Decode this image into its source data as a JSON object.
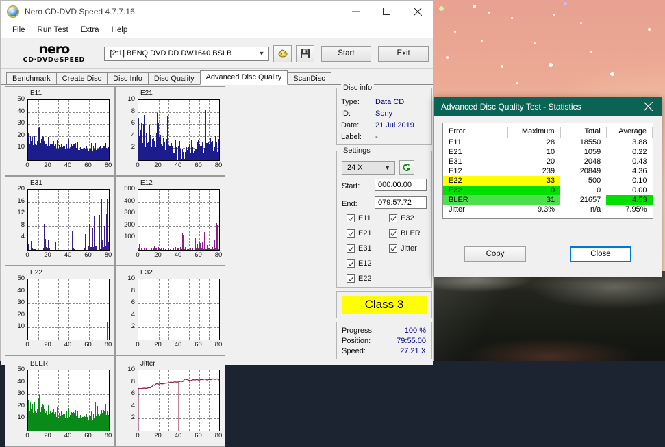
{
  "window": {
    "title": "Nero CD-DVD Speed 4.7.7.16",
    "icon": "nero-app-icon",
    "controls": {
      "minimize": "minimize-icon",
      "maximize": "maximize-icon",
      "close": "close-icon"
    }
  },
  "menu": {
    "items": [
      "File",
      "Run Test",
      "Extra",
      "Help"
    ]
  },
  "toolbar": {
    "logo_line1": "nero",
    "logo_line2": "CD·DVD⊘SPEED",
    "drive": "[2:1]   BENQ DVD DD DW1640 BSLB",
    "drive_arrow": "chevron-down-icon",
    "eject_icon": "eject-disc-icon",
    "save_icon": "floppy-save-icon",
    "start_label": "Start",
    "exit_label": "Exit"
  },
  "tabs": {
    "items": [
      "Benchmark",
      "Create Disc",
      "Disc Info",
      "Disc Quality",
      "Advanced Disc Quality",
      "ScanDisc"
    ],
    "active": "Advanced Disc Quality"
  },
  "disc_info": {
    "title": "Disc info",
    "rows": [
      {
        "label": "Type:",
        "value": "Data CD"
      },
      {
        "label": "ID:",
        "value": "Sony"
      },
      {
        "label": "Date:",
        "value": "21 Jul 2019"
      },
      {
        "label": "Label:",
        "value": "-"
      }
    ]
  },
  "settings": {
    "title": "Settings",
    "speed": "24 X",
    "speed_arrow": "chevron-down-icon",
    "refresh_icon": "refresh-speed-icon",
    "start_label": "Start:",
    "start_value": "000:00.00",
    "end_label": "End:",
    "end_value": "079:57.72",
    "checkboxes_left": [
      {
        "label": "E11",
        "checked": true
      },
      {
        "label": "E21",
        "checked": true
      },
      {
        "label": "E31",
        "checked": true
      },
      {
        "label": "E12",
        "checked": true
      },
      {
        "label": "E22",
        "checked": true
      }
    ],
    "checkboxes_right": [
      {
        "label": "E32",
        "checked": true
      },
      {
        "label": "BLER",
        "checked": true
      },
      {
        "label": "Jitter",
        "checked": true
      }
    ]
  },
  "class_result": {
    "label": "Class 3",
    "background": "#ffff00"
  },
  "progress_panel": {
    "rows": [
      {
        "label": "Progress:",
        "value": "100 %"
      },
      {
        "label": "Position:",
        "value": "79:55.00"
      },
      {
        "label": "Speed:",
        "value": "27.21 X"
      }
    ]
  },
  "stats_dialog": {
    "title": "Advanced Disc Quality Test - Statistics",
    "close_icon": "close-icon",
    "headers": [
      "Error",
      "Maximum",
      "Total",
      "Average"
    ],
    "rows": [
      {
        "error": "E11",
        "maximum": "28",
        "total": "18550",
        "average": "3.88",
        "highlight": null,
        "average_highlight": null
      },
      {
        "error": "E21",
        "maximum": "10",
        "total": "1059",
        "average": "0.22",
        "highlight": null,
        "average_highlight": null
      },
      {
        "error": "E31",
        "maximum": "20",
        "total": "2048",
        "average": "0.43",
        "highlight": null,
        "average_highlight": null
      },
      {
        "error": "E12",
        "maximum": "239",
        "total": "20849",
        "average": "4.36",
        "highlight": null,
        "average_highlight": null
      },
      {
        "error": "E22",
        "maximum": "33",
        "total": "500",
        "average": "0.10",
        "highlight": "#ffff00",
        "average_highlight": null
      },
      {
        "error": "E32",
        "maximum": "0",
        "total": "0",
        "average": "0.00",
        "highlight": "#00e000",
        "average_highlight": null
      },
      {
        "error": "BLER",
        "maximum": "31",
        "total": "21657",
        "average": "4.53",
        "highlight": "#4ce04c",
        "average_highlight": "#00e000"
      },
      {
        "error": "Jitter",
        "maximum": "9.3%",
        "total": "n/a",
        "average": "7.95%",
        "highlight": null,
        "average_highlight": null
      }
    ],
    "copy_label": "Copy",
    "close_label": "Close"
  },
  "chart_data": [
    {
      "type": "area",
      "title": "E11",
      "xlabel": "",
      "ylabel": "",
      "xlim": [
        0,
        80
      ],
      "ylim": [
        0,
        50
      ],
      "xticks": [
        0,
        20,
        40,
        60,
        80
      ],
      "yticks": [
        10,
        20,
        30,
        40,
        50
      ],
      "color": "#1c1c8c",
      "grid": true,
      "x": [
        0,
        1,
        2,
        3,
        4,
        5,
        6,
        7,
        8,
        9,
        10,
        11,
        12,
        13,
        14,
        15,
        16,
        17,
        18,
        19,
        20,
        21,
        22,
        23,
        24,
        25,
        26,
        27,
        28,
        29,
        30,
        31,
        32,
        33,
        34,
        35,
        36,
        37,
        38,
        39,
        40,
        41,
        42,
        43,
        44,
        45,
        46,
        47,
        48,
        49,
        50,
        51,
        52,
        53,
        54,
        55,
        56,
        57,
        58,
        59,
        60,
        61,
        62,
        63,
        64,
        65,
        66,
        67,
        68,
        69,
        70,
        71,
        72,
        73,
        74,
        75,
        76,
        77,
        78,
        79,
        80
      ],
      "values": [
        22,
        14,
        17,
        16,
        19,
        15,
        17,
        14,
        16,
        19,
        28,
        22,
        20,
        17,
        19,
        16,
        20,
        14,
        16,
        13,
        18,
        13,
        12,
        16,
        11,
        13,
        12,
        14,
        11,
        16,
        10,
        13,
        12,
        11,
        9,
        12,
        10,
        11,
        13,
        10,
        21,
        12,
        10,
        11,
        9,
        12,
        19,
        12,
        10,
        17,
        11,
        9,
        10,
        12,
        8,
        11,
        9,
        12,
        10,
        11,
        10,
        11,
        9,
        12,
        10,
        11,
        9,
        12,
        10,
        11,
        9,
        12,
        10,
        11,
        9,
        13,
        10,
        12,
        11,
        13,
        12
      ]
    },
    {
      "type": "area",
      "title": "E21",
      "xlabel": "",
      "ylabel": "",
      "xlim": [
        0,
        80
      ],
      "ylim": [
        0,
        10
      ],
      "xticks": [
        0,
        20,
        40,
        60,
        80
      ],
      "yticks": [
        2,
        4,
        6,
        8,
        10
      ],
      "color": "#1c1c8c",
      "grid": true,
      "x": [
        0,
        1,
        2,
        3,
        4,
        5,
        6,
        7,
        8,
        9,
        10,
        11,
        12,
        13,
        14,
        15,
        16,
        17,
        18,
        19,
        20,
        21,
        22,
        23,
        24,
        25,
        26,
        27,
        28,
        29,
        30,
        31,
        32,
        33,
        34,
        35,
        36,
        37,
        38,
        39,
        40,
        41,
        42,
        43,
        44,
        45,
        46,
        47,
        48,
        49,
        50,
        51,
        52,
        53,
        54,
        55,
        56,
        57,
        58,
        59,
        60,
        61,
        62,
        63,
        64,
        65,
        66,
        67,
        68,
        69,
        70,
        71,
        72,
        73,
        74,
        75,
        76,
        77,
        78,
        79,
        80
      ],
      "values": [
        7,
        2,
        4,
        7,
        2,
        9,
        4,
        2,
        6,
        3,
        2,
        5,
        4,
        2,
        5,
        3,
        4,
        2,
        6,
        8,
        5,
        2,
        4,
        3,
        2,
        5,
        3,
        2,
        4,
        7,
        3,
        2,
        4,
        2,
        3,
        1,
        2,
        4,
        1,
        0,
        3,
        4,
        1,
        0,
        2,
        1,
        0,
        3,
        2,
        1,
        3,
        2,
        1,
        4,
        2,
        1,
        3,
        2,
        1,
        4,
        2,
        3,
        1,
        2,
        4,
        1,
        3,
        7,
        2,
        4,
        3,
        1,
        4,
        2,
        3,
        1,
        2,
        6,
        3,
        1,
        4
      ]
    },
    {
      "type": "area",
      "title": "E31",
      "xlabel": "",
      "ylabel": "",
      "xlim": [
        0,
        80
      ],
      "ylim": [
        0,
        20
      ],
      "xticks": [
        0,
        20,
        40,
        60,
        80
      ],
      "yticks": [
        4,
        8,
        12,
        16,
        20
      ],
      "color": "#3d1f8c",
      "grid": true,
      "x": [
        0,
        1,
        2,
        3,
        4,
        5,
        6,
        7,
        8,
        9,
        10,
        11,
        12,
        13,
        14,
        15,
        16,
        17,
        18,
        19,
        20,
        21,
        22,
        23,
        24,
        25,
        26,
        27,
        28,
        29,
        30,
        31,
        32,
        33,
        34,
        35,
        36,
        37,
        38,
        39,
        40,
        41,
        42,
        43,
        44,
        45,
        46,
        47,
        48,
        49,
        50,
        51,
        52,
        53,
        54,
        55,
        56,
        57,
        58,
        59,
        60,
        61,
        62,
        63,
        64,
        65,
        66,
        67,
        68,
        69,
        70,
        71,
        72,
        73,
        74,
        75,
        76,
        77,
        78,
        79,
        80
      ],
      "values": [
        17,
        0,
        0,
        4,
        5,
        0,
        2,
        1,
        0,
        0,
        0,
        0,
        0,
        0,
        0,
        0,
        12,
        4,
        0,
        4,
        3,
        4,
        0,
        0,
        0,
        0,
        0,
        4,
        0,
        0,
        0,
        0,
        0,
        0,
        0,
        0,
        0,
        0,
        0,
        0,
        0,
        0,
        0,
        0,
        8,
        6,
        0,
        0,
        0,
        0,
        0,
        0,
        0,
        0,
        0,
        0,
        0,
        7,
        0,
        0,
        12,
        8,
        8,
        8,
        7,
        8,
        13,
        9,
        12,
        0,
        0,
        13,
        0,
        20,
        0,
        8,
        8,
        11,
        12,
        20,
        20
      ]
    },
    {
      "type": "area",
      "title": "E12",
      "xlabel": "",
      "ylabel": "",
      "xlim": [
        0,
        80
      ],
      "ylim": [
        0,
        500
      ],
      "xticks": [
        0,
        20,
        40,
        60,
        80
      ],
      "yticks": [
        100,
        200,
        300,
        400,
        500
      ],
      "color": "#8c1f8c",
      "grid": true,
      "x": [
        0,
        1,
        2,
        3,
        4,
        5,
        6,
        7,
        8,
        9,
        10,
        11,
        12,
        13,
        14,
        15,
        16,
        17,
        18,
        19,
        20,
        21,
        22,
        23,
        24,
        25,
        26,
        27,
        28,
        29,
        30,
        31,
        32,
        33,
        34,
        35,
        36,
        37,
        38,
        39,
        40,
        41,
        42,
        43,
        44,
        45,
        46,
        47,
        48,
        49,
        50,
        51,
        52,
        53,
        54,
        55,
        56,
        57,
        58,
        59,
        60,
        61,
        62,
        63,
        64,
        65,
        66,
        67,
        68,
        69,
        70,
        71,
        72,
        73,
        74,
        75,
        76,
        77,
        78,
        79,
        80
      ],
      "values": [
        140,
        10,
        20,
        15,
        20,
        10,
        15,
        10,
        20,
        15,
        10,
        25,
        15,
        20,
        10,
        15,
        45,
        20,
        15,
        25,
        20,
        15,
        30,
        10,
        20,
        15,
        10,
        40,
        15,
        20,
        10,
        25,
        30,
        15,
        20,
        10,
        15,
        25,
        20,
        10,
        20,
        15,
        30,
        25,
        170,
        60,
        30,
        20,
        15,
        40,
        25,
        15,
        20,
        25,
        15,
        20,
        25,
        130,
        60,
        40,
        190,
        50,
        60,
        90,
        50,
        70,
        195,
        60,
        50,
        30,
        190,
        35,
        40,
        30,
        20,
        60,
        80,
        110,
        230,
        190,
        60
      ]
    },
    {
      "type": "area",
      "title": "E22",
      "xlabel": "",
      "ylabel": "",
      "xlim": [
        0,
        80
      ],
      "ylim": [
        0,
        50
      ],
      "xticks": [
        0,
        20,
        40,
        60,
        80
      ],
      "yticks": [
        10,
        20,
        30,
        40,
        50
      ],
      "color": "#8c1f8c",
      "grid": true,
      "x": [
        0,
        10,
        20,
        30,
        40,
        50,
        60,
        70,
        78,
        79,
        80
      ],
      "values": [
        0,
        0,
        0,
        0,
        0,
        0,
        0,
        0,
        0,
        31,
        0
      ]
    },
    {
      "type": "area",
      "title": "E32",
      "xlabel": "",
      "ylabel": "",
      "xlim": [
        0,
        80
      ],
      "ylim": [
        0,
        10
      ],
      "xticks": [
        0,
        20,
        40,
        60,
        80
      ],
      "yticks": [
        2,
        4,
        6,
        8,
        10
      ],
      "color": "#8c1f8c",
      "grid": true,
      "x": [
        0,
        10,
        20,
        30,
        40,
        50,
        60,
        70,
        80
      ],
      "values": [
        0,
        0,
        0,
        0,
        0,
        0,
        0,
        0,
        0
      ]
    },
    {
      "type": "area",
      "title": "BLER",
      "xlabel": "",
      "ylabel": "",
      "xlim": [
        0,
        80
      ],
      "ylim": [
        0,
        50
      ],
      "xticks": [
        0,
        20,
        40,
        60,
        80
      ],
      "yticks": [
        10,
        20,
        30,
        40,
        50
      ],
      "color": "#0a8a19",
      "grid": true,
      "x": [
        0,
        1,
        2,
        3,
        4,
        5,
        6,
        7,
        8,
        9,
        10,
        11,
        12,
        13,
        14,
        15,
        16,
        17,
        18,
        19,
        20,
        21,
        22,
        23,
        24,
        25,
        26,
        27,
        28,
        29,
        30,
        31,
        32,
        33,
        34,
        35,
        36,
        37,
        38,
        39,
        40,
        41,
        42,
        43,
        44,
        45,
        46,
        47,
        48,
        49,
        50,
        51,
        52,
        53,
        54,
        55,
        56,
        57,
        58,
        59,
        60,
        61,
        62,
        63,
        64,
        65,
        66,
        67,
        68,
        69,
        70,
        71,
        72,
        73,
        74,
        75,
        76,
        77,
        78,
        79,
        80
      ],
      "values": [
        25,
        17,
        20,
        18,
        22,
        17,
        20,
        16,
        19,
        22,
        27,
        24,
        22,
        19,
        21,
        18,
        22,
        16,
        18,
        15,
        20,
        15,
        14,
        18,
        13,
        15,
        14,
        16,
        13,
        18,
        12,
        15,
        14,
        13,
        11,
        14,
        12,
        13,
        15,
        12,
        22,
        14,
        12,
        13,
        11,
        14,
        20,
        14,
        12,
        18,
        13,
        11,
        12,
        14,
        10,
        13,
        11,
        14,
        12,
        13,
        12,
        13,
        11,
        14,
        12,
        13,
        11,
        20,
        12,
        25,
        11,
        14,
        12,
        22,
        11,
        19,
        13,
        20,
        14,
        25,
        15
      ]
    },
    {
      "type": "line",
      "title": "Jitter",
      "xlabel": "",
      "ylabel": "",
      "xlim": [
        0,
        80
      ],
      "ylim": [
        0,
        10
      ],
      "xticks": [
        0,
        20,
        40,
        60,
        80
      ],
      "yticks": [
        2,
        4,
        6,
        8,
        10
      ],
      "color": "#8c1f4c",
      "grid": true,
      "x": [
        0,
        2,
        4,
        6,
        8,
        10,
        12,
        14,
        15,
        16,
        18,
        20,
        22,
        24,
        26,
        28,
        30,
        32,
        34,
        36,
        38,
        40,
        42,
        44,
        46,
        48,
        50,
        52,
        54,
        56,
        58,
        60,
        62,
        64,
        66,
        68,
        70,
        72,
        74,
        76,
        78,
        80
      ],
      "values": [
        7.0,
        6.95,
        7.0,
        7.05,
        7.0,
        7.1,
        7.1,
        7.4,
        7.6,
        7.5,
        7.8,
        7.7,
        7.8,
        7.75,
        7.85,
        7.9,
        7.9,
        8.05,
        8.0,
        8.1,
        8.05,
        8.1,
        8.2,
        8.15,
        8.55,
        8.5,
        8.35,
        8.3,
        8.45,
        8.4,
        8.5,
        8.35,
        8.5,
        8.45,
        8.6,
        8.4,
        8.5,
        8.45,
        8.6,
        8.5,
        8.6,
        8.4
      ]
    }
  ]
}
